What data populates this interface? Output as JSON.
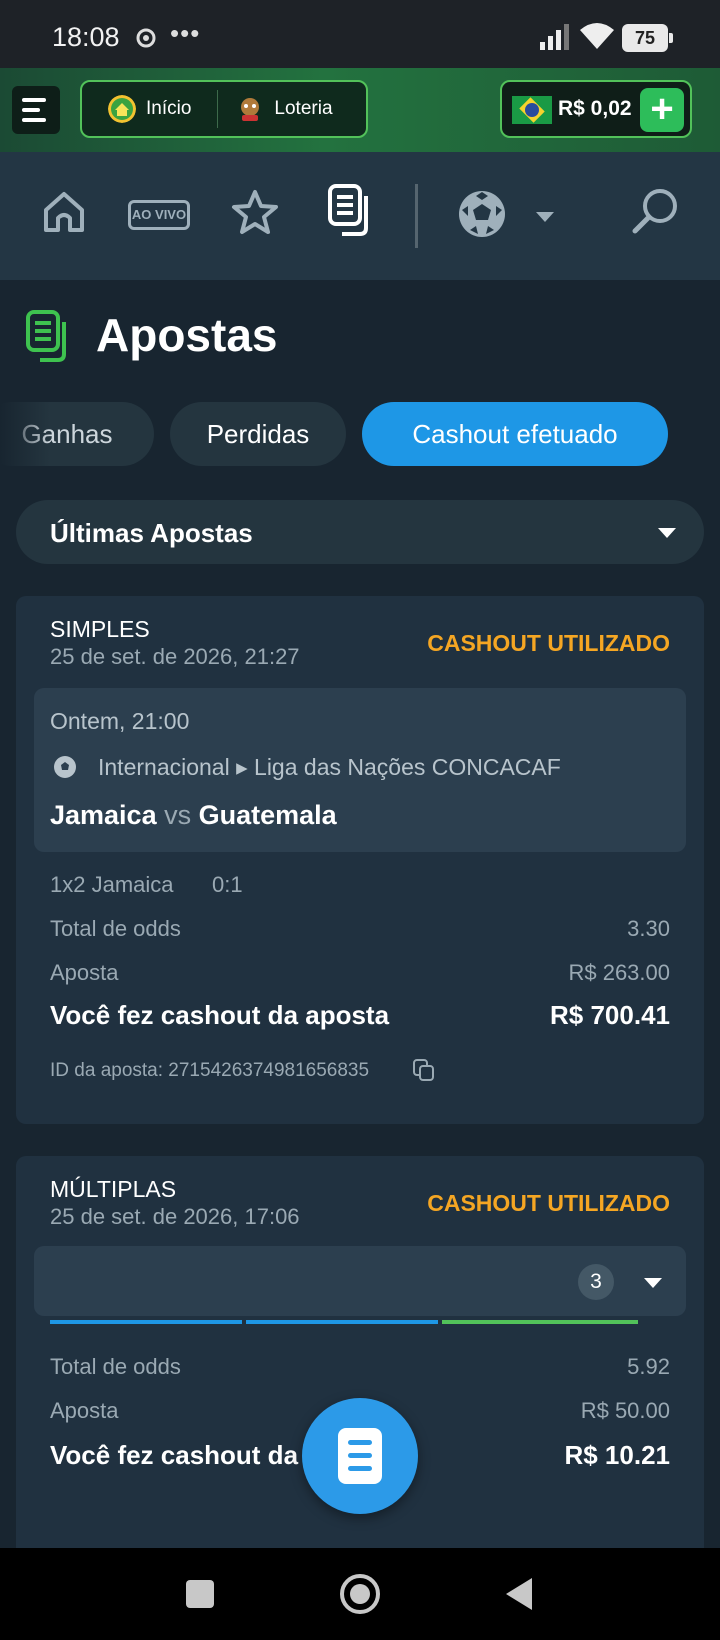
{
  "status_bar": {
    "time": "18:08",
    "dots": "•••",
    "battery": "75"
  },
  "header": {
    "nav_items": [
      {
        "label": "Início",
        "icon": "home-icon"
      },
      {
        "label": "Loteria",
        "icon": "lottery-icon"
      }
    ],
    "balance": "R$ 0,02",
    "deposit_icon": "plus-icon"
  },
  "toolbar": {
    "items": [
      "home-icon",
      "live-icon",
      "star-icon",
      "bets-icon",
      "soccer-ball-icon",
      "search-icon"
    ],
    "live_label": "AO VIVO"
  },
  "page": {
    "title": "Apostas"
  },
  "filter_chips": [
    {
      "label": "Ganhas",
      "active": false
    },
    {
      "label": "Perdidas",
      "active": false
    },
    {
      "label": "Cashout efetuado",
      "active": true
    }
  ],
  "period_dropdown": {
    "selected": "Últimas Apostas"
  },
  "bets": [
    {
      "type": "SIMPLES",
      "date": "25 de set. de 2026, 21:27",
      "status": "CASHOUT UTILIZADO",
      "event": {
        "when": "Ontem, 21:00",
        "league": "Internacional ▸ Liga das Nações CONCACAF",
        "home": "Jamaica",
        "vs": "vs",
        "away": "Guatemala"
      },
      "selection": "1x2 Jamaica",
      "score": "0:1",
      "odds_label": "Total de odds",
      "odds": "3.30",
      "stake_label": "Aposta",
      "stake": "R$ 263.00",
      "cashout_label": "Você fez cashout da aposta",
      "cashout": "R$ 700.41",
      "id_text": "ID da aposta: 2715426374981656835"
    },
    {
      "type": "MÚLTIPLAS",
      "date": "25 de set. de 2026, 17:06",
      "status": "CASHOUT UTILIZADO",
      "selections_count": "3",
      "odds_label": "Total de odds",
      "odds": "5.92",
      "stake_label": "Aposta",
      "stake": "R$ 50.00",
      "cashout_label": "Você fez cashout da aposta",
      "cashout": "R$ 10.21"
    }
  ],
  "colors": {
    "background": "#182530",
    "card": "#203140",
    "accent_blue": "#1e97e6",
    "status_orange": "#f5a623",
    "brand_green": "#2dbd5a"
  }
}
